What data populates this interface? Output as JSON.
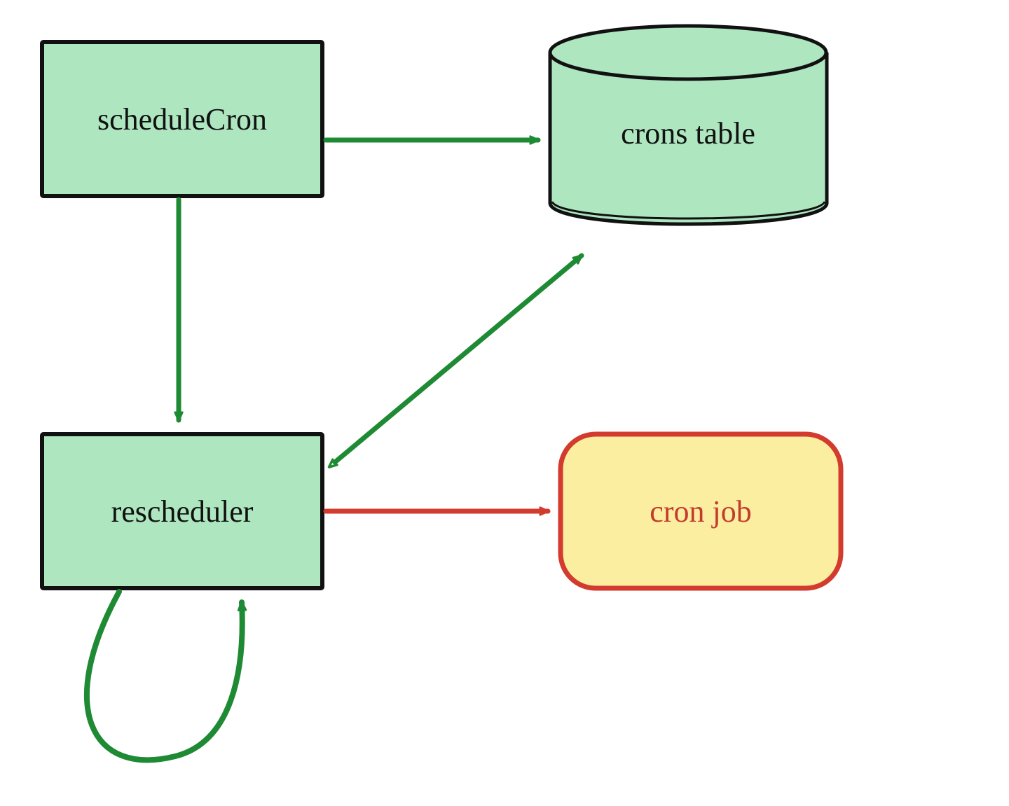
{
  "nodes": {
    "scheduleCron": {
      "label": "scheduleCron"
    },
    "cronsTable": {
      "label": "crons table"
    },
    "rescheduler": {
      "label": "rescheduler"
    },
    "cronJob": {
      "label": "cron job"
    }
  },
  "colors": {
    "greenFill": "#aee6c0",
    "greenStroke": "#1f8a34",
    "yellowFill": "#fceea0",
    "redStroke": "#d23b2e",
    "blackStroke": "#111111"
  },
  "edges": [
    {
      "from": "scheduleCron",
      "to": "cronsTable",
      "color": "green",
      "bidirectional": false
    },
    {
      "from": "scheduleCron",
      "to": "rescheduler",
      "color": "green",
      "bidirectional": false
    },
    {
      "from": "rescheduler",
      "to": "cronsTable",
      "color": "green",
      "bidirectional": true
    },
    {
      "from": "rescheduler",
      "to": "cronJob",
      "color": "red",
      "bidirectional": false
    },
    {
      "from": "rescheduler",
      "to": "rescheduler",
      "color": "green",
      "bidirectional": false,
      "selfLoop": true
    }
  ]
}
